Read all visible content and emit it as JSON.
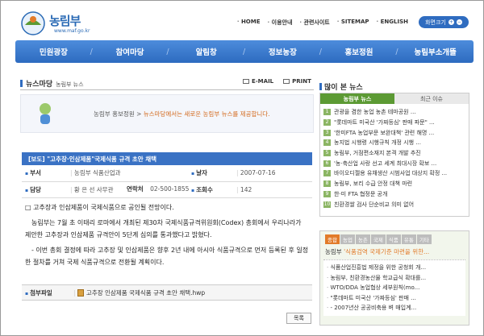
{
  "header": {
    "logo_text": "농림부",
    "logo_url": "www.maf.go.kr",
    "util_links": [
      "HOME",
      "이용안내",
      "관련사이트",
      "SITEMAP",
      "ENGLISH"
    ],
    "zoom_label": "화면크기"
  },
  "gnb": [
    "민원광장",
    "참여마당",
    "알림창",
    "정보농장",
    "홍보정원",
    "농림부소개뜰"
  ],
  "section": {
    "title": "뉴스마당",
    "subtitle": "농림부 뉴스",
    "email": "E-MAIL",
    "print": "PRINT"
  },
  "banner": {
    "path": "농림부 홍보정원 > ",
    "desc": "뉴스마당에서는 새로운 농림부 뉴스를 제공합니다."
  },
  "article": {
    "title": "[보도] \"고추장·인삼제품\"국제식품 규격 초안 채택",
    "dept_label": "부서",
    "dept": "농림부 식품산업과",
    "date_label": "날자",
    "date": "2007-07-16",
    "person_label": "담당",
    "person": "황 은 선 사무관",
    "contact_label": "연락처",
    "contact": "02-500-1855",
    "views_label": "조회수",
    "views": "142",
    "para1": "□ 고추장과 인삼제품이 국제식품으로 공인될 전망이다.",
    "para2": "농림부는 7월 초 이태리 로마에서 개최된 제30차 국제식품규격위원회(Codex) 총회에서 우리나라가 제안한 고추장과 인삼제품 규격안이 5단계 심의를 통과했다고 밝혔다.",
    "para3": "- 이번 총회 결정에 따라 고추장 및 인삼제품은 향후 2년 내에 아시아 식품규격으로 먼저 등록된 후 일정한 절차를 거쳐 국제 식품규격으로 전환될 계획이다.",
    "attach_label": "첨부파일",
    "attach_file": "고추장 인삼제품 국제식품 규격 초안 채택.hwp",
    "list_button": "목록"
  },
  "popular": {
    "title": "많이 본 뉴스",
    "tab_on": "농림부 뉴스",
    "tab_off": "최근 이슈",
    "items": [
      "관광을 겸한 농업 농촌 테마공원 ...",
      "\"롯데마트 미국산 '가짜등심' 판매 파문\" ...",
      "'한미FTA 농업부문 보완대책' 관련 해명 ...",
      "농지법 시행령 시행규칙 개정 시행 ...",
      "농림부, 거점편소재지 본격 개발 추진",
      "'농·축산업 사랑 선고 세계 최대시장 확보 ...",
      "바이오디젤용 유채생산 시범사업 대상지 확정 ...",
      "농림부, 보리 수급 안정 대책 마련",
      "한·미 FTA 협정문 공개",
      "친환경쌀 검사 단순비교 의미 없어"
    ]
  },
  "news2": {
    "categories": [
      "종합",
      "농업",
      "농촌",
      "국제",
      "식품",
      "유통",
      "기타"
    ],
    "headline_prefix": "농림부 ",
    "headline": "'식품검역 국제기준 마련을 위한...",
    "items": [
      "식품산업진흥법 제정을 위한 공청회 개...",
      "농림부, 친환경농산물 학교급식 확대를...",
      "WTO/DDA 농업협상 세부원칙(mo...",
      "\"롯데마트 미국산 '가짜등심' 판매 ...",
      "- 2007년산 공공비축용 벼 매입계..."
    ]
  },
  "colors": {
    "primary_blue": "#2f6cc0",
    "green": "#5c9a34",
    "orange": "#e27b2a"
  }
}
